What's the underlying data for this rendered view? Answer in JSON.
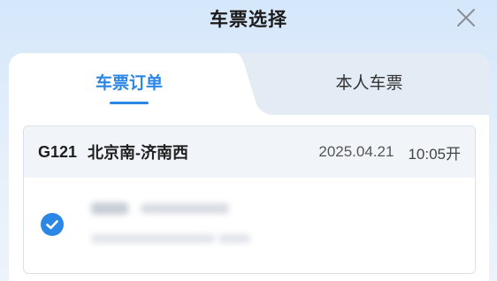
{
  "header": {
    "title": "车票选择"
  },
  "tabs": [
    {
      "label": "车票订单",
      "active": true
    },
    {
      "label": "本人车票",
      "active": false
    }
  ],
  "order": {
    "train_no": "G121",
    "route": "北京南-济南西",
    "date": "2025.04.21",
    "depart": "10:05开",
    "passenger": {
      "selected": true
    }
  },
  "colors": {
    "accent": "#2b86e6",
    "background_top": "#d5e7fb",
    "card_header_bg": "#f1f5fa"
  }
}
